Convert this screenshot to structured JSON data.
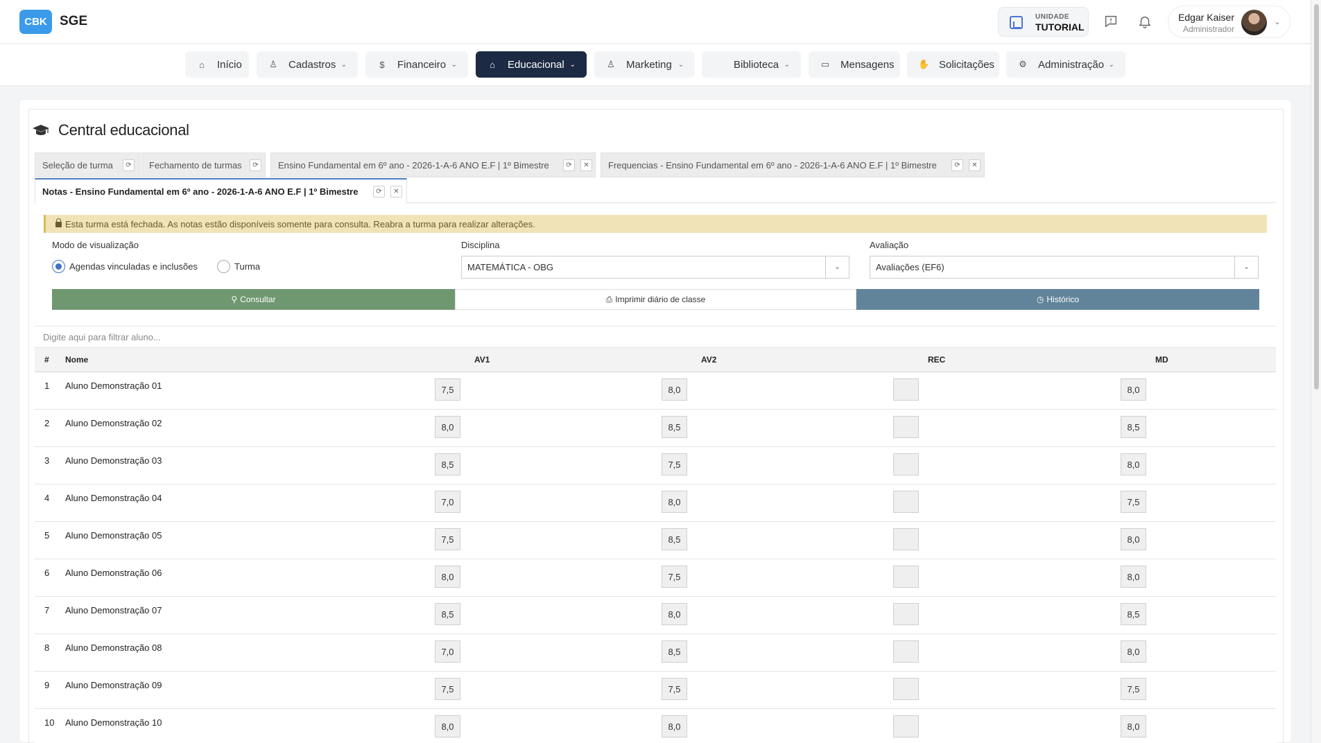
{
  "header": {
    "logo_text": "CBK",
    "app_name": "SGE",
    "unit_label": "UNIDADE",
    "unit_value": "TUTORIAL",
    "user_name": "Edgar Kaiser",
    "user_role": "Administrador"
  },
  "nav": [
    {
      "label": "Início",
      "icon": "home-icon",
      "dropdown": false,
      "active": false
    },
    {
      "label": "Cadastros",
      "icon": "users-icon",
      "dropdown": true,
      "active": false
    },
    {
      "label": "Financeiro",
      "icon": "dollar-icon",
      "dropdown": true,
      "active": false
    },
    {
      "label": "Educacional",
      "icon": "graduation-icon",
      "dropdown": true,
      "active": true
    },
    {
      "label": "Marketing",
      "icon": "users-icon",
      "dropdown": true,
      "active": false
    },
    {
      "label": "Biblioteca",
      "icon": "book-icon",
      "dropdown": true,
      "active": false
    },
    {
      "label": "Mensagens",
      "icon": "folder-icon",
      "dropdown": false,
      "active": false
    },
    {
      "label": "Solicitações",
      "icon": "hand-icon",
      "dropdown": false,
      "active": false
    },
    {
      "label": "Administração",
      "icon": "gear-icon",
      "dropdown": true,
      "active": false
    }
  ],
  "page": {
    "title": "Central educacional"
  },
  "tabs": [
    {
      "label": "Seleção de turma",
      "closable": false
    },
    {
      "label": "Fechamento de turmas",
      "closable": false
    },
    {
      "label": "Ensino Fundamental em 6º ano - 2026-1-A-6 ANO E.F | 1º Bimestre",
      "closable": true
    },
    {
      "label": "Frequencias - Ensino Fundamental em 6º ano - 2026-1-A-6 ANO E.F | 1º Bimestre",
      "closable": true
    },
    {
      "label": "Notas - Ensino Fundamental em 6º ano - 2026-1-A-6 ANO E.F | 1º Bimestre",
      "closable": true,
      "active": true
    }
  ],
  "alert": {
    "text": "Esta turma está fechada. As notas estão disponíveis somente para consulta. Reabra a turma para realizar alterações."
  },
  "form": {
    "view_mode_label": "Modo de visualização",
    "view_mode_options": [
      "Agendas vinculadas e inclusões",
      "Turma"
    ],
    "view_mode_selected": "Agendas vinculadas e inclusões",
    "disciplina_label": "Disciplina",
    "disciplina_value": "MATEMÁTICA - OBG",
    "avaliacao_label": "Avaliação",
    "avaliacao_value": "Avaliações (EF6)"
  },
  "actions": {
    "consultar": "Consultar",
    "imprimir": "Imprimir diário de classe",
    "historico": "Histórico"
  },
  "filter": {
    "placeholder": "Digite aqui para filtrar aluno..."
  },
  "table": {
    "headers": [
      "#",
      "Nome",
      "AV1",
      "AV2",
      "REC",
      "MD"
    ],
    "rows": [
      {
        "num": "1",
        "name": "Aluno Demonstração 01",
        "av1": "7,5",
        "av2": "8,0",
        "rec": "",
        "md": "8,0"
      },
      {
        "num": "2",
        "name": "Aluno Demonstração 02",
        "av1": "8,0",
        "av2": "8,5",
        "rec": "",
        "md": "8,5"
      },
      {
        "num": "3",
        "name": "Aluno Demonstração 03",
        "av1": "8,5",
        "av2": "7,5",
        "rec": "",
        "md": "8,0"
      },
      {
        "num": "4",
        "name": "Aluno Demonstração 04",
        "av1": "7,0",
        "av2": "8,0",
        "rec": "",
        "md": "7,5"
      },
      {
        "num": "5",
        "name": "Aluno Demonstração 05",
        "av1": "7,5",
        "av2": "8,5",
        "rec": "",
        "md": "8,0"
      },
      {
        "num": "6",
        "name": "Aluno Demonstração 06",
        "av1": "8,0",
        "av2": "7,5",
        "rec": "",
        "md": "8,0"
      },
      {
        "num": "7",
        "name": "Aluno Demonstração 07",
        "av1": "8,5",
        "av2": "8,0",
        "rec": "",
        "md": "8,5"
      },
      {
        "num": "8",
        "name": "Aluno Demonstração 08",
        "av1": "7,0",
        "av2": "8,5",
        "rec": "",
        "md": "8,0"
      },
      {
        "num": "9",
        "name": "Aluno Demonstração 09",
        "av1": "7,5",
        "av2": "7,5",
        "rec": "",
        "md": "7,5"
      },
      {
        "num": "10",
        "name": "Aluno Demonstração 10",
        "av1": "8,0",
        "av2": "8,0",
        "rec": "",
        "md": "8,0"
      }
    ]
  },
  "colors": {
    "accent": "#3b9bea",
    "nav_active": "#1c2a44",
    "consultar_bg": "#6f9870",
    "historico_bg": "#61849b",
    "alert_bg": "#f1e3b8"
  }
}
